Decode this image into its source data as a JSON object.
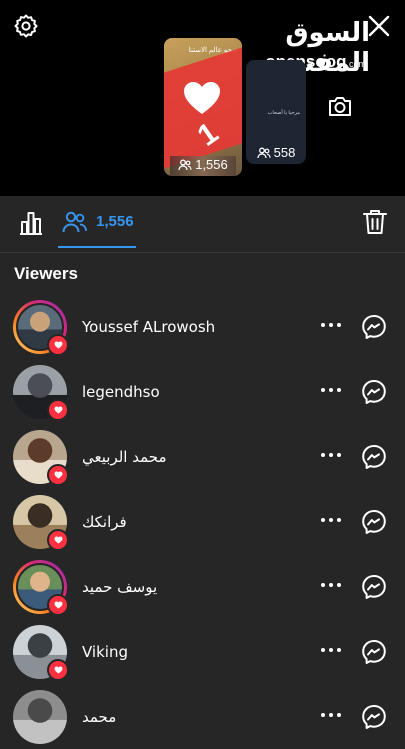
{
  "watermark": {
    "arabic": "السوق المفتوح",
    "latin": "opensooq",
    "latin_suffix": ".com"
  },
  "stories": [
    {
      "viewer_count": "1,556",
      "overlay_number": "1",
      "caption_text": "صحو عالم الاستنا"
    },
    {
      "viewer_count": "558",
      "caption_text": "مرحبا يا أصحاب"
    }
  ],
  "tabs": {
    "viewers_count": "1,556"
  },
  "section_title": "Viewers",
  "viewers": [
    {
      "name": "Youssef ALrowosh",
      "has_story_ring": true,
      "liked": true,
      "avatar_colors": [
        "#5a6b7a",
        "#c9a27a",
        "#2f3a45"
      ]
    },
    {
      "name": "legendhso",
      "has_story_ring": false,
      "liked": true,
      "avatar_colors": [
        "#9aa0a6",
        "#4b4f55",
        "#1d1f22"
      ]
    },
    {
      "name": "محمد الربيعي",
      "has_story_ring": false,
      "liked": true,
      "avatar_colors": [
        "#b9a68f",
        "#5c3b2a",
        "#e8dccb"
      ]
    },
    {
      "name": "فرانكك",
      "has_story_ring": false,
      "liked": true,
      "avatar_colors": [
        "#d8c7a6",
        "#3a2e24",
        "#9c7f5b"
      ]
    },
    {
      "name": "يوسف حميد",
      "has_story_ring": true,
      "liked": true,
      "avatar_colors": [
        "#6a8f5a",
        "#e0b48a",
        "#3c5a7a"
      ]
    },
    {
      "name": "Viking",
      "has_story_ring": false,
      "liked": true,
      "avatar_colors": [
        "#cdd2d6",
        "#3b4045",
        "#8b9096"
      ]
    },
    {
      "name": "محمد",
      "has_story_ring": false,
      "liked": false,
      "avatar_colors": [
        "#8d8d8d",
        "#4a4a4a",
        "#c2c2c2"
      ]
    }
  ],
  "colors": {
    "accent": "#3797f0",
    "like": "#ff3040",
    "background": "#262626"
  },
  "icons": {
    "settings": "gear-icon",
    "close": "close-icon",
    "camera": "camera-icon",
    "insights": "bar-chart-icon",
    "viewers": "people-icon",
    "delete": "trash-icon",
    "more": "more-horizontal-icon",
    "message": "messenger-icon",
    "like": "heart-icon"
  }
}
